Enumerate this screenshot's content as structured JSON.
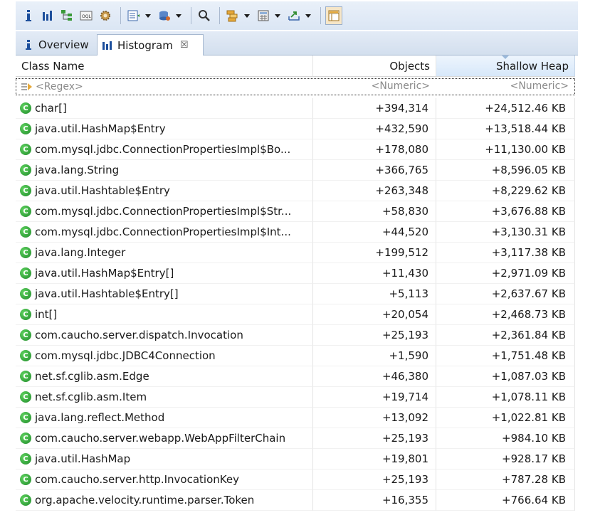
{
  "toolbar": {
    "buttons": [
      "info-icon",
      "histogram-icon",
      "dominator-tree-icon",
      "oql-icon",
      "gear-icon",
      "query-browser-icon",
      "heap-dump-icon",
      "search-icon",
      "group-by-icon",
      "calculator-icon",
      "export-icon",
      "compare-icon"
    ]
  },
  "tabs": {
    "overview_label": "Overview",
    "histogram_label": "Histogram",
    "close_glyph": "☒"
  },
  "columns": {
    "name": "Class Name",
    "objects": "Objects",
    "heap": "Shallow Heap"
  },
  "filter": {
    "name": "<Regex>",
    "objects": "<Numeric>",
    "heap": "<Numeric>"
  },
  "colors": {
    "class_icon": "#2ea53a",
    "header_selected": "#d7e8fa"
  },
  "rows": [
    {
      "name": "char[]",
      "objects": "+394,314",
      "heap": "+24,512.46 KB"
    },
    {
      "name": "java.util.HashMap$Entry",
      "objects": "+432,590",
      "heap": "+13,518.44 KB"
    },
    {
      "name": "com.mysql.jdbc.ConnectionPropertiesImpl$Bo...",
      "objects": "+178,080",
      "heap": "+11,130.00 KB"
    },
    {
      "name": "java.lang.String",
      "objects": "+366,765",
      "heap": "+8,596.05 KB"
    },
    {
      "name": "java.util.Hashtable$Entry",
      "objects": "+263,348",
      "heap": "+8,229.62 KB"
    },
    {
      "name": "com.mysql.jdbc.ConnectionPropertiesImpl$Str...",
      "objects": "+58,830",
      "heap": "+3,676.88 KB"
    },
    {
      "name": "com.mysql.jdbc.ConnectionPropertiesImpl$Int...",
      "objects": "+44,520",
      "heap": "+3,130.31 KB"
    },
    {
      "name": "java.lang.Integer",
      "objects": "+199,512",
      "heap": "+3,117.38 KB"
    },
    {
      "name": "java.util.HashMap$Entry[]",
      "objects": "+11,430",
      "heap": "+2,971.09 KB"
    },
    {
      "name": "java.util.Hashtable$Entry[]",
      "objects": "+5,113",
      "heap": "+2,637.67 KB"
    },
    {
      "name": "int[]",
      "objects": "+20,054",
      "heap": "+2,468.73 KB"
    },
    {
      "name": "com.caucho.server.dispatch.Invocation",
      "objects": "+25,193",
      "heap": "+2,361.84 KB"
    },
    {
      "name": "com.mysql.jdbc.JDBC4Connection",
      "objects": "+1,590",
      "heap": "+1,751.48 KB"
    },
    {
      "name": "net.sf.cglib.asm.Edge",
      "objects": "+46,380",
      "heap": "+1,087.03 KB"
    },
    {
      "name": "net.sf.cglib.asm.Item",
      "objects": "+19,714",
      "heap": "+1,078.11 KB"
    },
    {
      "name": "java.lang.reflect.Method",
      "objects": "+13,092",
      "heap": "+1,022.81 KB"
    },
    {
      "name": "com.caucho.server.webapp.WebAppFilterChain",
      "objects": "+25,193",
      "heap": "+984.10 KB"
    },
    {
      "name": "java.util.HashMap",
      "objects": "+19,801",
      "heap": "+928.17 KB"
    },
    {
      "name": "com.caucho.server.http.InvocationKey",
      "objects": "+25,193",
      "heap": "+787.28 KB"
    },
    {
      "name": "org.apache.velocity.runtime.parser.Token",
      "objects": "+16,355",
      "heap": "+766.64 KB"
    }
  ]
}
